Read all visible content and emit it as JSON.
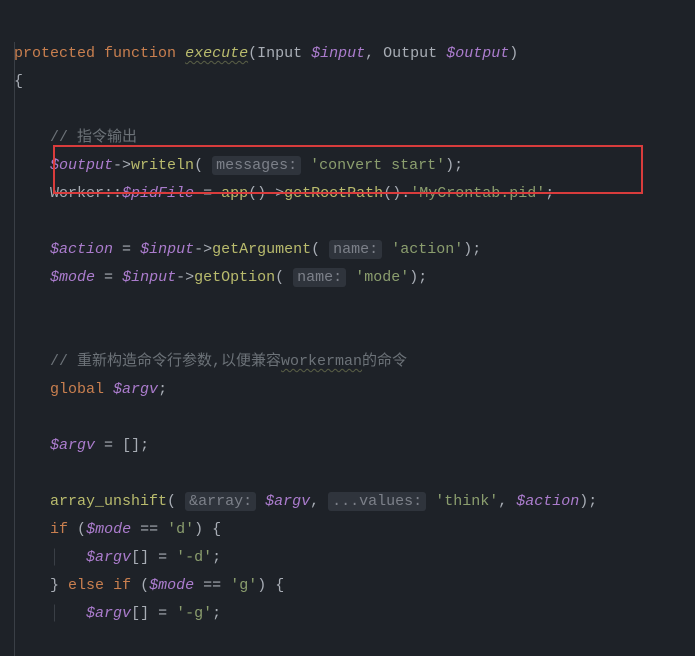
{
  "code": {
    "line1": {
      "kw1": "protected",
      "kw2": "function",
      "fn": "execute",
      "type1": "Input",
      "param1": "$input",
      "type2": "Output",
      "param2": "$output"
    },
    "line2": {
      "brace": "{"
    },
    "line4": {
      "comment": "// 指令输出"
    },
    "line5": {
      "var": "$output",
      "fn": "writeln",
      "hint": "messages:",
      "str": "'convert start'"
    },
    "line6": {
      "class": "Worker",
      "static": "$pidFile",
      "fn1": "app",
      "fn2": "getRootPath",
      "str": "'MyCrontab.pid'"
    },
    "line8": {
      "var1": "$action",
      "var2": "$input",
      "fn": "getArgument",
      "hint": "name:",
      "str": "'action'"
    },
    "line9": {
      "var1": "$mode",
      "var2": "$input",
      "fn": "getOption",
      "hint": "name:",
      "str": "'mode'"
    },
    "line12": {
      "comment1": "// 重新构造命令行参数,以便兼容",
      "wavy": "workerman",
      "comment2": "的命令"
    },
    "line13": {
      "kw": "global",
      "var": "$argv"
    },
    "line15": {
      "var": "$argv"
    },
    "line17": {
      "fn": "array_unshift",
      "hint1": "&array:",
      "var1": "$argv",
      "hint2": "...values:",
      "str": "'think'",
      "var2": "$action"
    },
    "line18": {
      "kw": "if",
      "var": "$mode",
      "str": "'d'"
    },
    "line19": {
      "var": "$argv",
      "str": "'-d'"
    },
    "line20": {
      "kw1": "else",
      "kw2": "if",
      "var": "$mode",
      "str": "'g'"
    },
    "line21": {
      "var": "$argv",
      "str": "'-g'"
    }
  }
}
